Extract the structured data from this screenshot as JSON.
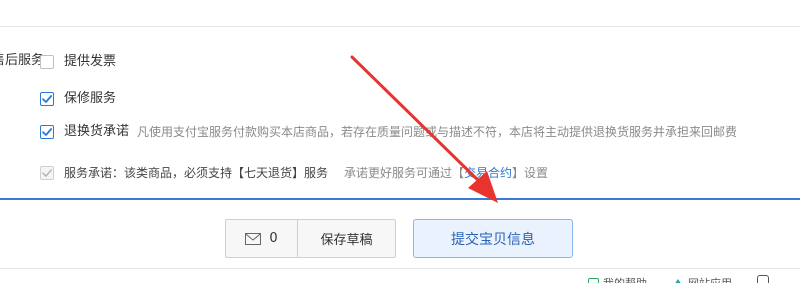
{
  "services": {
    "section_label": "售后服务",
    "invoice_label": "提供发票",
    "warranty_label": "保修服务",
    "return_label": "退换货承诺",
    "return_hint": "凡使用支付宝服务付款购买本店商品，若存在质量问题或与描述不符，本店将主动提供退换货服务并承担来回邮费",
    "promise_label": "服务承诺：该类商品，必须支持【七天退货】服务",
    "promise_hint_prefix": "承诺更好服务可通过【",
    "promise_hint_link": "交易合约",
    "promise_hint_suffix": "】设置"
  },
  "checkboxes": {
    "invoice": false,
    "warranty": true,
    "return": true,
    "promise": true
  },
  "actions": {
    "message_count": "0",
    "save_draft_label": "保存草稿",
    "submit_label": "提交宝贝信息"
  },
  "bottom_bar": {
    "item1": "我的帮助",
    "item2": "网站应用"
  },
  "colors": {
    "accent": "#3a7bd5",
    "arrow": "#e8332f",
    "submit_bg": "#e9f2fd"
  }
}
